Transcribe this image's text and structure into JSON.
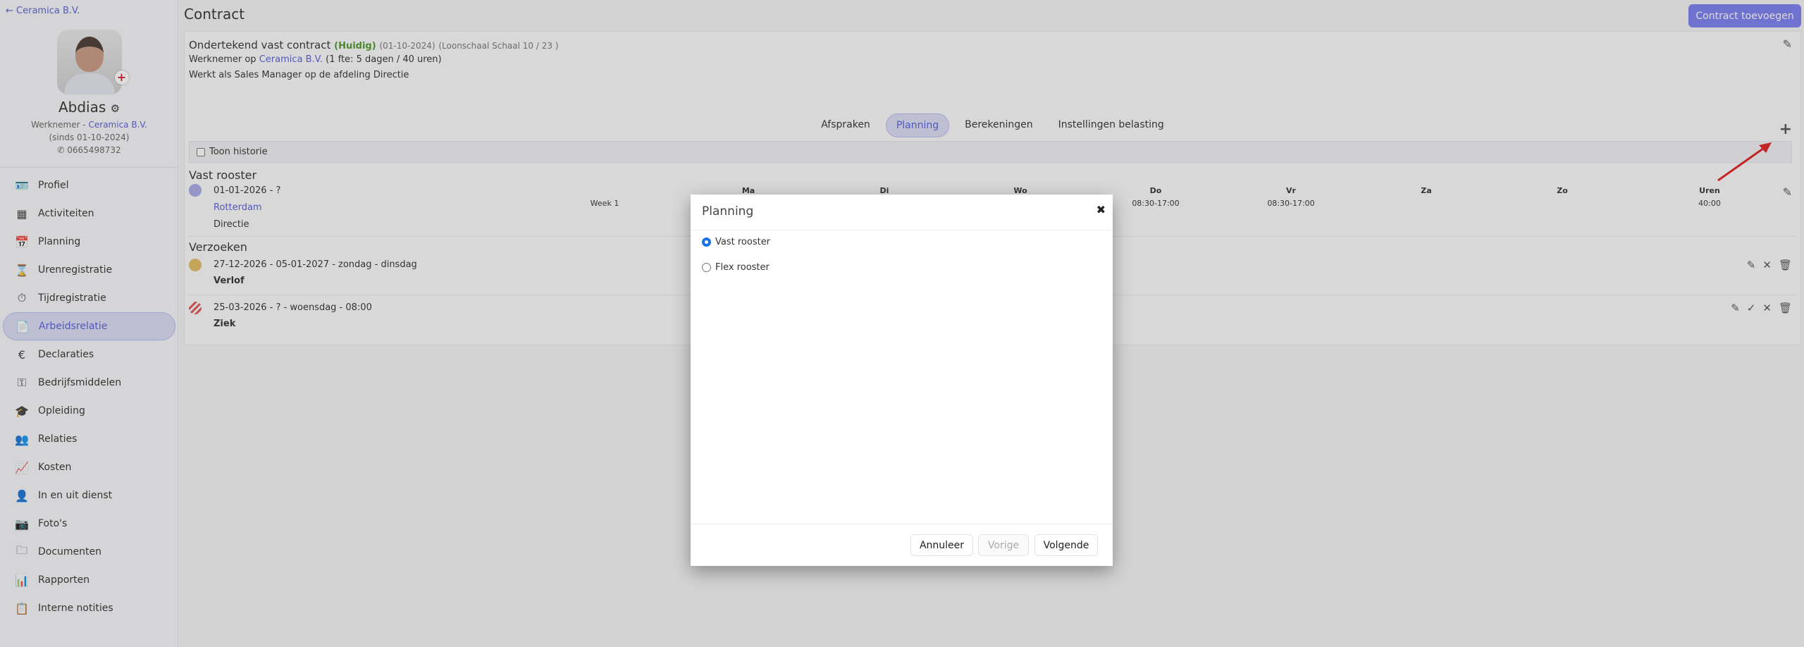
{
  "sidebar": {
    "back_label": "Ceramica B.V.",
    "name": "Abdias",
    "role": "Werknemer - ",
    "company": "Ceramica B.V.",
    "since": "(sinds 01-10-2024)",
    "phone": "0665498732",
    "items": [
      {
        "label": "Profiel",
        "icon": "id-card-icon"
      },
      {
        "label": "Activiteiten",
        "icon": "table-icon"
      },
      {
        "label": "Planning",
        "icon": "calendar-icon"
      },
      {
        "label": "Urenregistratie",
        "icon": "hourglass-icon"
      },
      {
        "label": "Tijdregistratie",
        "icon": "stopwatch-icon"
      },
      {
        "label": "Arbeidsrelatie",
        "icon": "document-icon"
      },
      {
        "label": "Declaraties",
        "icon": "euro-icon"
      },
      {
        "label": "Bedrijfsmiddelen",
        "icon": "key-icon"
      },
      {
        "label": "Opleiding",
        "icon": "graduate-icon"
      },
      {
        "label": "Relaties",
        "icon": "users-icon"
      },
      {
        "label": "Kosten",
        "icon": "chart-area-icon"
      },
      {
        "label": "In en uit dienst",
        "icon": "user-check-icon"
      },
      {
        "label": "Foto's",
        "icon": "camera-icon"
      },
      {
        "label": "Documenten",
        "icon": "folder-icon"
      },
      {
        "label": "Rapporten",
        "icon": "report-icon"
      },
      {
        "label": "Interne notities",
        "icon": "clipboard-icon"
      }
    ]
  },
  "header": {
    "title": "Contract",
    "add_button": "Contract toevoegen"
  },
  "contract": {
    "title": "Ondertekend vast contract",
    "status": "(Huidig)",
    "date": "(01-10-2024)",
    "scale": "(Loonschaal Schaal 10 / 23 )",
    "employee_prefix": "Werknemer op",
    "company": "Ceramica B.V.",
    "fte": "(1 fte: 5 dagen / 40 uren)",
    "role_line": "Werkt als Sales Manager op de afdeling Directie"
  },
  "tabs": [
    "Afspraken",
    "Planning",
    "Berekeningen",
    "Instellingen belasting"
  ],
  "history_label": "Toon historie",
  "vast": {
    "title": "Vast rooster",
    "period": "01-01-2026 - ?",
    "location": "Rotterdam",
    "department": "Directie",
    "week": "Week 1",
    "days": [
      "Ma",
      "Di",
      "Wo",
      "Do",
      "Vr",
      "Za",
      "Zo",
      "Uren"
    ],
    "values": [
      "",
      "",
      "",
      "08:30-17:00",
      "08:30-17:00",
      "",
      "",
      "40:00"
    ],
    "color": "#a9aae6"
  },
  "requests": {
    "title": "Verzoeken",
    "items": [
      {
        "period": "27-12-2026 - 05-01-2027 - zondag - dinsdag",
        "type": "Verlof",
        "color": "#e2bc62"
      },
      {
        "period": "25-03-2026 - ? - woensdag - 08:00",
        "type": "Ziek",
        "color": "#e05a5a"
      }
    ]
  },
  "modal": {
    "title": "Planning",
    "options": [
      {
        "label": "Vast rooster",
        "checked": true
      },
      {
        "label": "Flex rooster",
        "checked": false
      }
    ],
    "cancel": "Annuleer",
    "prev": "Vorige",
    "next": "Volgende"
  },
  "colors": {
    "accent": "#7b7ff0",
    "link": "#5a5fd6",
    "current": "#4f9a2c"
  }
}
